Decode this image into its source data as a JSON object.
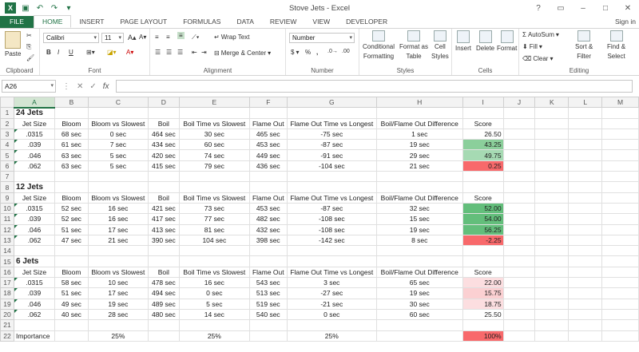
{
  "window": {
    "title": "Stove Jets - Excel",
    "signin": "Sign in"
  },
  "tabs": [
    "FILE",
    "HOME",
    "INSERT",
    "PAGE LAYOUT",
    "FORMULAS",
    "DATA",
    "REVIEW",
    "VIEW",
    "DEVELOPER"
  ],
  "ribbon": {
    "clipboard": {
      "label": "Clipboard",
      "paste": "Paste"
    },
    "font": {
      "label": "Font",
      "name": "Calibri",
      "size": "11",
      "bold": "B",
      "italic": "I",
      "underline": "U"
    },
    "alignment": {
      "label": "Alignment",
      "wrap": "Wrap Text",
      "merge": "Merge & Center"
    },
    "number": {
      "label": "Number",
      "format": "Number",
      "currency": "$",
      "percent": "%",
      "comma": ","
    },
    "styles": {
      "label": "Styles",
      "conditional": "Conditional",
      "formatting": "Formatting",
      "format_as": "Format as",
      "table": "Table",
      "cell": "Cell",
      "styles": "Styles"
    },
    "cells": {
      "label": "Cells",
      "insert": "Insert",
      "delete": "Delete",
      "format": "Format"
    },
    "editing": {
      "label": "Editing",
      "autosum": "AutoSum",
      "fill": "Fill",
      "clear": "Clear",
      "sort": "Sort &",
      "filter": "Filter",
      "find": "Find &",
      "select": "Select"
    }
  },
  "formula_bar": {
    "namebox": "A26",
    "fx": "fx",
    "content": ""
  },
  "columns": [
    "A",
    "B",
    "C",
    "D",
    "E",
    "F",
    "G",
    "H",
    "I",
    "J",
    "K",
    "L",
    "M"
  ],
  "rows": [
    {
      "n": "1",
      "cells": [
        "24 Jets",
        "",
        "",
        "",
        "",
        "",
        "",
        "",
        "",
        "",
        "",
        "",
        ""
      ],
      "bold": true
    },
    {
      "n": "2",
      "cells": [
        "Jet Size",
        "Bloom",
        "Bloom vs Slowest",
        "Boil",
        "Boil Time vs Slowest",
        "Flame Out",
        "Flame Out Time vs Longest",
        "Boil/Flame Out Difference",
        "Score",
        "",
        "",
        "",
        ""
      ]
    },
    {
      "n": "3",
      "cells": [
        ".0315",
        "68 sec",
        "0 sec",
        "464 sec",
        "30 sec",
        "465 sec",
        "-75 sec",
        "1 sec",
        "26.50",
        "",
        "",
        "",
        ""
      ]
    },
    {
      "n": "4",
      "cells": [
        ".039",
        "61 sec",
        "7 sec",
        "434 sec",
        "60 sec",
        "453 sec",
        "-87 sec",
        "19 sec",
        "43.25",
        "",
        "",
        "",
        ""
      ]
    },
    {
      "n": "5",
      "cells": [
        ".046",
        "63 sec",
        "5 sec",
        "420 sec",
        "74 sec",
        "449 sec",
        "-91 sec",
        "29 sec",
        "49.75",
        "",
        "",
        "",
        ""
      ]
    },
    {
      "n": "6",
      "cells": [
        ".062",
        "63 sec",
        "5 sec",
        "415 sec",
        "79 sec",
        "436 sec",
        "-104 sec",
        "21 sec",
        "0.25",
        "",
        "",
        "",
        ""
      ]
    },
    {
      "n": "7",
      "cells": [
        "",
        "",
        "",
        "",
        "",
        "",
        "",
        "",
        "",
        "",
        "",
        "",
        ""
      ]
    },
    {
      "n": "8",
      "cells": [
        "12 Jets",
        "",
        "",
        "",
        "",
        "",
        "",
        "",
        "",
        "",
        "",
        "",
        ""
      ],
      "bold": true
    },
    {
      "n": "9",
      "cells": [
        "Jet Size",
        "Bloom",
        "Bloom vs Slowest",
        "Boil",
        "Boil Time vs Slowest",
        "Flame Out",
        "Flame Out Time vs Longest",
        "Boil/Flame Out Difference",
        "Score",
        "",
        "",
        "",
        ""
      ]
    },
    {
      "n": "10",
      "cells": [
        ".0315",
        "52 sec",
        "16 sec",
        "421 sec",
        "73 sec",
        "453 sec",
        "-87 sec",
        "32 sec",
        "52.00",
        "",
        "",
        "",
        ""
      ]
    },
    {
      "n": "11",
      "cells": [
        ".039",
        "52 sec",
        "16 sec",
        "417 sec",
        "77 sec",
        "482 sec",
        "-108 sec",
        "15 sec",
        "54.00",
        "",
        "",
        "",
        ""
      ]
    },
    {
      "n": "12",
      "cells": [
        ".046",
        "51 sec",
        "17 sec",
        "413 sec",
        "81 sec",
        "432 sec",
        "-108 sec",
        "19 sec",
        "56.25",
        "",
        "",
        "",
        ""
      ]
    },
    {
      "n": "13",
      "cells": [
        ".062",
        "47 sec",
        "21 sec",
        "390 sec",
        "104 sec",
        "398 sec",
        "-142 sec",
        "8 sec",
        "-2.25",
        "",
        "",
        "",
        ""
      ]
    },
    {
      "n": "14",
      "cells": [
        "",
        "",
        "",
        "",
        "",
        "",
        "",
        "",
        "",
        "",
        "",
        "",
        ""
      ]
    },
    {
      "n": "15",
      "cells": [
        "6 Jets",
        "",
        "",
        "",
        "",
        "",
        "",
        "",
        "",
        "",
        "",
        "",
        ""
      ],
      "bold": true
    },
    {
      "n": "16",
      "cells": [
        "Jet Size",
        "Bloom",
        "Bloom vs Slowest",
        "Boil",
        "Boil Time vs Slowest",
        "Flame Out",
        "Flame Out Time vs Longest",
        "Boil/Flame Out Difference",
        "Score",
        "",
        "",
        "",
        ""
      ]
    },
    {
      "n": "17",
      "cells": [
        ".0315",
        "58 sec",
        "10 sec",
        "478 sec",
        "16 sec",
        "543 sec",
        "3 sec",
        "65 sec",
        "22.00",
        "",
        "",
        "",
        ""
      ]
    },
    {
      "n": "18",
      "cells": [
        ".039",
        "51 sec",
        "17 sec",
        "494 sec",
        "0 sec",
        "513 sec",
        "-27 sec",
        "19 sec",
        "15.75",
        "",
        "",
        "",
        ""
      ]
    },
    {
      "n": "19",
      "cells": [
        ".046",
        "49 sec",
        "19 sec",
        "489 sec",
        "5 sec",
        "519 sec",
        "-21 sec",
        "30 sec",
        "18.75",
        "",
        "",
        "",
        ""
      ]
    },
    {
      "n": "20",
      "cells": [
        ".062",
        "40 sec",
        "28 sec",
        "480 sec",
        "14 sec",
        "540 sec",
        "0 sec",
        "60 sec",
        "25.50",
        "",
        "",
        "",
        ""
      ]
    },
    {
      "n": "21",
      "cells": [
        "",
        "",
        "",
        "",
        "",
        "",
        "",
        "",
        "",
        "",
        "",
        "",
        ""
      ]
    },
    {
      "n": "22",
      "cells": [
        "Importance",
        "",
        "25%",
        "",
        "25%",
        "",
        "25%",
        "",
        "100%",
        "",
        "",
        "",
        ""
      ]
    }
  ],
  "score_colors": {
    "3": "",
    "4": "g2",
    "5": "g5",
    "6": "rd1",
    "10": "g1",
    "11": "g1",
    "12": "g1",
    "13": "rd1",
    "17": "rd3",
    "18": "rd2",
    "19": "rd3",
    "20": "",
    "22": "rd1"
  }
}
